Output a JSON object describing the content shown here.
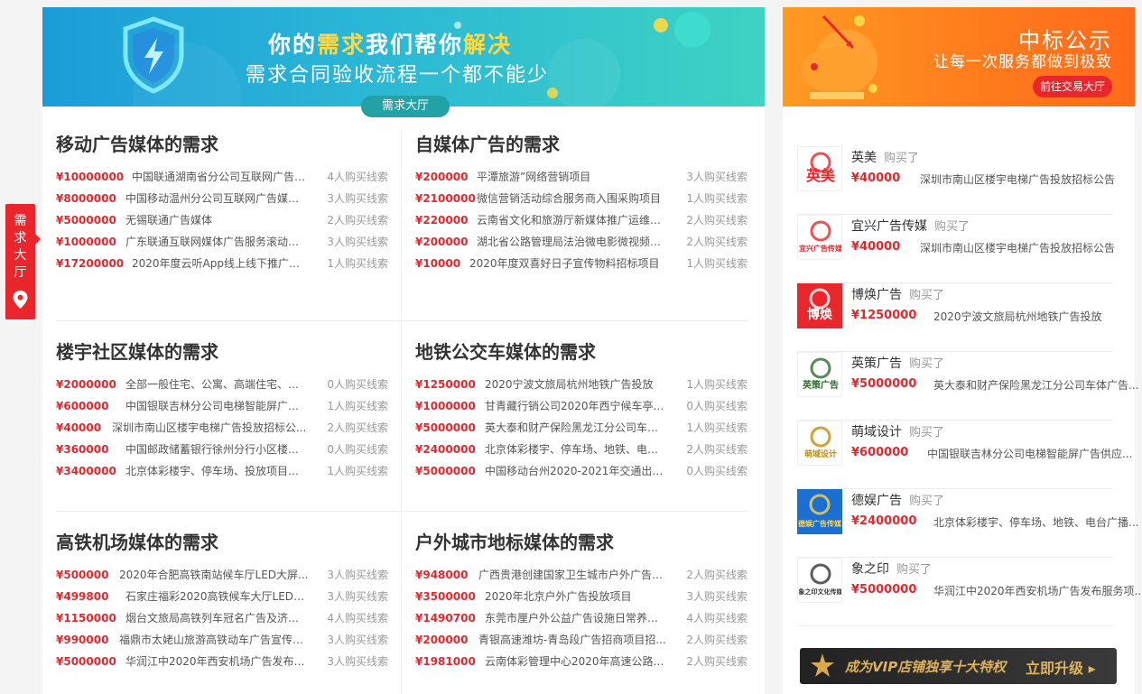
{
  "side_tab": {
    "label": "需求大厅",
    "icon": "location-pin-icon"
  },
  "banner": {
    "line1_a": "你的",
    "line1_b": "需求",
    "line1_c": "我们帮你",
    "line1_d": "解决",
    "line2": "需求合同验收流程一个都不能少",
    "button": "需求大厅",
    "icon": "shield-lightning-icon"
  },
  "sections": [
    {
      "title": "移动广告媒体的需求",
      "rows": [
        {
          "price": "¥10000000",
          "name": "中国联通湖南省分公司互联网广告宣...",
          "count": "4人购买线索"
        },
        {
          "price": "¥8000000",
          "name": "中国移动温州分公司互联网广告媒介...",
          "count": "3人购买线索"
        },
        {
          "price": "¥5000000",
          "name": "无锡联通广告媒体",
          "count": "2人购买线索"
        },
        {
          "price": "¥1000000",
          "name": "广东联通互联网媒体广告服务滚动招...",
          "count": "3人购买线索"
        },
        {
          "price": "¥17200000",
          "name": "2020年度云听App线上线下推广项目",
          "count": "1人购买线索"
        }
      ]
    },
    {
      "title": "自媒体广告的需求",
      "rows": [
        {
          "price": "¥200000",
          "name": "平潭旅游”网络营销项目",
          "count": "3人购买线索"
        },
        {
          "price": "¥2100000",
          "name": "微信营销活动综合服务商入围采购项目",
          "count": "1人购买线索"
        },
        {
          "price": "¥220000",
          "name": "云南省文化和旅游厅新媒体推广运维项...",
          "count": "2人购买线索"
        },
        {
          "price": "¥200000",
          "name": "湖北省公路管理局法治微电影微视频宣...",
          "count": "2人购买线索"
        },
        {
          "price": "¥10000",
          "name": "2020年度双喜好日子宣传物料招标项目",
          "count": "1人购买线索"
        }
      ]
    },
    {
      "title": "楼宇社区媒体的需求",
      "rows": [
        {
          "price": "¥2000000",
          "name": "全部一般住宅、公寓、高端住宅、框...",
          "count": "0人购买线索"
        },
        {
          "price": "¥600000",
          "name": "中国银联吉林分公司电梯智能屏广告供...",
          "count": "1人购买线索"
        },
        {
          "price": "¥40000",
          "name": "深圳市南山区楼宇电梯广告投放招标公...",
          "count": "2人购买线索"
        },
        {
          "price": "¥360000",
          "name": "中国邮政储蓄银行徐州分行小区楼宇广...",
          "count": "0人购买线索"
        },
        {
          "price": "¥3400000",
          "name": "北京体彩楼宇、停车场、投放项目招...",
          "count": "1人购买线索"
        }
      ]
    },
    {
      "title": "地铁公交车媒体的需求",
      "rows": [
        {
          "price": "¥1250000",
          "name": "2020宁波文旅局杭州地铁广告投放",
          "count": "1人购买线索"
        },
        {
          "price": "¥1000000",
          "name": "甘青藏行销公司2020年西宁候车亭广...",
          "count": "0人购买线索"
        },
        {
          "price": "¥5000000",
          "name": "英大泰和财产保险黑龙江分公司车体...",
          "count": "1人购买线索"
        },
        {
          "price": "¥2400000",
          "name": "北京体彩楼宇、停车场、地铁、电台...",
          "count": "2人购买线索"
        },
        {
          "price": "¥5000000",
          "name": "中国移动台州2020-2021年交通出行...",
          "count": "0人购买线索"
        }
      ]
    },
    {
      "title": "高铁机场媒体的需求",
      "rows": [
        {
          "price": "¥500000",
          "name": "2020年合肥高铁南站候车厅LED大屏...",
          "count": "3人购买线索"
        },
        {
          "price": "¥499800",
          "name": "石家庄福彩2020高铁候车大厅LED屏...",
          "count": "3人购买线索"
        },
        {
          "price": "¥1150000",
          "name": "烟台文旅局高铁列车冠名广告及济南...",
          "count": "4人购买线索"
        },
        {
          "price": "¥990000",
          "name": "福鼎市太姥山旅游高铁动车广告宣传项...",
          "count": "3人购买线索"
        },
        {
          "price": "¥5000000",
          "name": "华润江中2020年西安机场广告发布服...",
          "count": "3人购买线索"
        }
      ]
    },
    {
      "title": "户外城市地标媒体的需求",
      "rows": [
        {
          "price": "¥948000",
          "name": "广西贵港创建国家卫生城市户外广告宣...",
          "count": "2人购买线索"
        },
        {
          "price": "¥3500000",
          "name": "2020年北京户外广告投放项目",
          "count": "3人购买线索"
        },
        {
          "price": "¥1490700",
          "name": "东莞市厘户外公益广告设施日常养护...",
          "count": "4人购买线索"
        },
        {
          "price": "¥200000",
          "name": "青银高速潍坊-青岛段广告招商项目招...",
          "count": "2人购买线索"
        },
        {
          "price": "¥1981000",
          "name": "云南体彩管理中心2020年高速公路户...",
          "count": "2人购买线索"
        }
      ]
    }
  ],
  "side_banner": {
    "title": "中标公示",
    "subtitle": "让每一次服务都做到极致",
    "button": "前往交易大厅"
  },
  "bought_label": "购买了",
  "bidders": [
    {
      "name": "英美",
      "logo_text": "英美",
      "price": "¥40000",
      "project": "深圳市南山区楼宇电梯广告投放招标公告"
    },
    {
      "name": "宜兴广告传媒",
      "logo_text": "宜兴广告传媒",
      "price": "¥40000",
      "project": "深圳市南山区楼宇电梯广告投放招标公告"
    },
    {
      "name": "博焕广告",
      "logo_text": "博焕",
      "price": "¥1250000",
      "project": "2020宁波文旅局杭州地铁广告投放"
    },
    {
      "name": "英策广告",
      "logo_text": "英策广告",
      "price": "¥5000000",
      "project": "英大泰和财产保险黑龙江分公司车体广告..."
    },
    {
      "name": "萌域设计",
      "logo_text": "萌域设计",
      "price": "¥600000",
      "project": "中国银联吉林分公司电梯智能屏广告供应..."
    },
    {
      "name": "德娱广告",
      "logo_text": "德娱广告传媒",
      "price": "¥2400000",
      "project": "北京体彩楼宇、停车场、地铁、电台广播..."
    },
    {
      "name": "象之印",
      "logo_text": "象之印文化传媒",
      "price": "¥5000000",
      "project": "华润江中2020年西安机场广告发布服务项..."
    }
  ],
  "vip": {
    "text": "成为VIP店铺独享十大特权",
    "button": "立即升级"
  },
  "colors": {
    "accent_red": "#e8262b",
    "banner_teal": "#2bb7d6",
    "side_orange": "#ff7a1c"
  }
}
